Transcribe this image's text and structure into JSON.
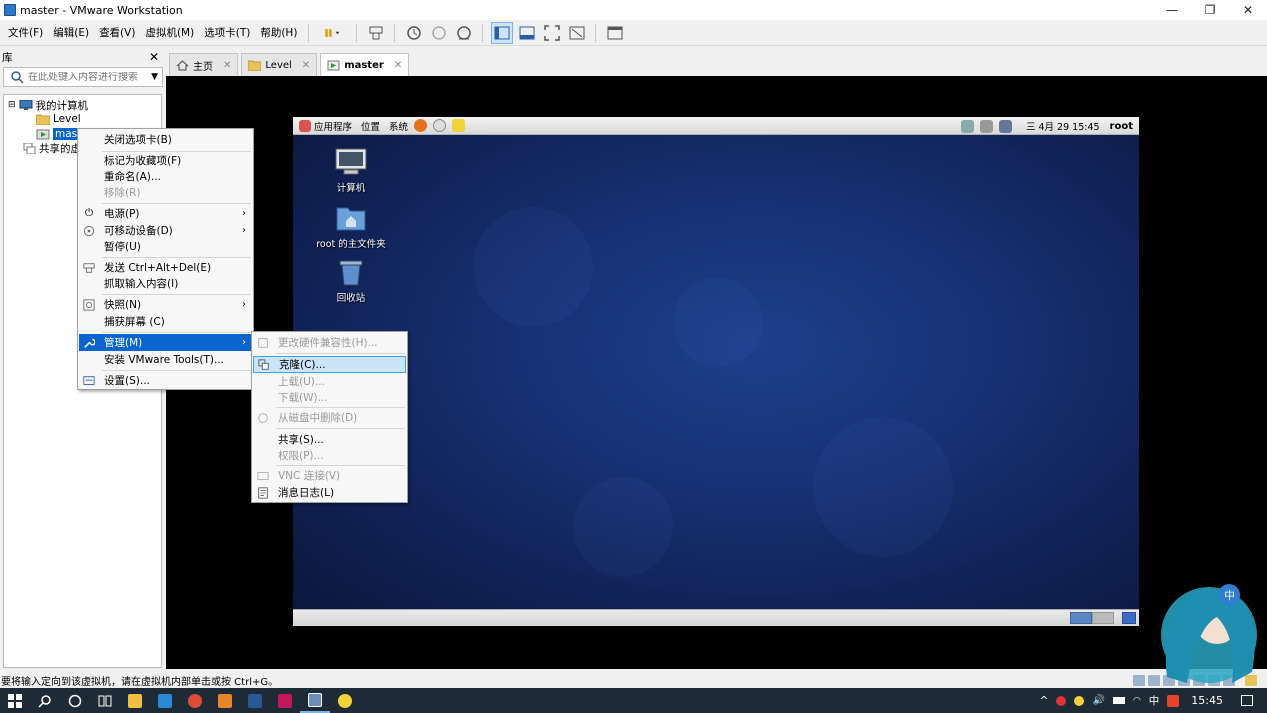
{
  "window": {
    "title": "master - VMware Workstation",
    "controls": {
      "minimize": "—",
      "maximize": "❐",
      "close": "✕"
    }
  },
  "menubar": {
    "items": [
      "文件(F)",
      "编辑(E)",
      "查看(V)",
      "虚拟机(M)",
      "选项卡(T)",
      "帮助(H)"
    ]
  },
  "library": {
    "title": "库",
    "close": "✕",
    "search_placeholder": "在此处键入内容进行搜索",
    "tree": {
      "root": "我的计算机",
      "child1": "Level",
      "child2": "mast",
      "shared": "共享的虚"
    }
  },
  "tabs": [
    {
      "label": "主页",
      "close": "✕"
    },
    {
      "label": "Level",
      "close": "✕"
    },
    {
      "label": "master",
      "close": "✕"
    }
  ],
  "guest": {
    "panel": {
      "apps": "应用程序",
      "places": "位置",
      "system": "系统",
      "clock": "三 4月 29 15:45",
      "user": "root"
    },
    "icons": {
      "computer": "计算机",
      "home": "root 的主文件夹",
      "trash": "回收站"
    }
  },
  "context_menu": {
    "close_tab": "关闭选项卡(B)",
    "favorite": "标记为收藏项(F)",
    "rename": "重命名(A)...",
    "remove": "移除(R)",
    "power": "电源(P)",
    "removable": "可移动设备(D)",
    "pause": "暂停(U)",
    "send_cad": "发送 Ctrl+Alt+Del(E)",
    "grab_input": "抓取输入内容(I)",
    "snapshot": "快照(N)",
    "capture": "捕获屏幕 (C)",
    "manage": "管理(M)",
    "install_tools": "安装 VMware Tools(T)...",
    "settings": "设置(S)...",
    "arrow": "›"
  },
  "submenu": {
    "hw_compat": "更改硬件兼容性(H)...",
    "clone": "克隆(C)...",
    "upload": "上载(U)...",
    "download": "下载(W)...",
    "delete_disk": "从磁盘中删除(D)",
    "share": "共享(S)...",
    "permissions": "权限(P)...",
    "vnc": "VNC 连接(V)",
    "log": "消息日志(L)"
  },
  "statusbar": {
    "text": "要将输入定向到该虚拟机，请在虚拟机内部单击或按 Ctrl+G。"
  },
  "taskbar": {
    "tray_up": "^",
    "ime": "中",
    "clock": "15:45"
  },
  "colors": {
    "accent": "#0a64d0",
    "taskbar": "#1e2a36",
    "desktop": "#173275"
  }
}
